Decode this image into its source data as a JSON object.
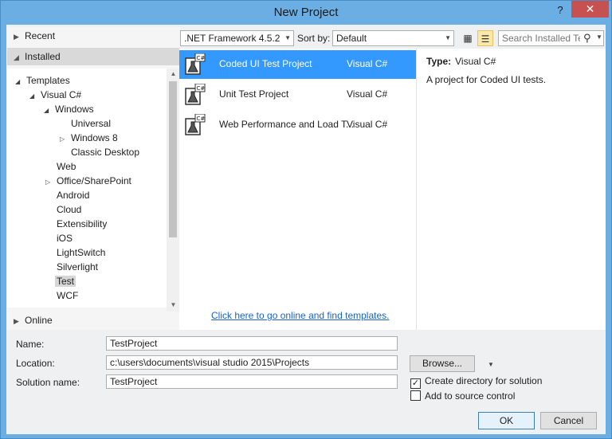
{
  "window": {
    "title": "New Project",
    "help": "?",
    "close": "✕"
  },
  "left": {
    "recent": "Recent",
    "installed": "Installed",
    "online": "Online",
    "tree": [
      {
        "label": "Templates"
      },
      {
        "label": "Visual C#"
      },
      {
        "label": "Windows"
      },
      {
        "label": "Universal"
      },
      {
        "label": "Windows 8"
      },
      {
        "label": "Classic Desktop"
      },
      {
        "label": "Web"
      },
      {
        "label": "Office/SharePoint"
      },
      {
        "label": "Android"
      },
      {
        "label": "Cloud"
      },
      {
        "label": "Extensibility"
      },
      {
        "label": "iOS"
      },
      {
        "label": "LightSwitch"
      },
      {
        "label": "Silverlight"
      },
      {
        "label": "Test"
      },
      {
        "label": "WCF"
      }
    ]
  },
  "toolbar": {
    "framework": ".NET Framework 4.5.2",
    "sort_label": "Sort by:",
    "sort_value": "Default",
    "search_placeholder": "Search Installed Te"
  },
  "templates": [
    {
      "name": "Coded UI Test Project",
      "lang": "Visual C#"
    },
    {
      "name": "Unit Test Project",
      "lang": "Visual C#"
    },
    {
      "name": "Web Performance and Load T...",
      "lang": "Visual C#"
    }
  ],
  "online_link": "Click here to go online and find templates.",
  "description": {
    "type_label": "Type:",
    "type_value": "Visual C#",
    "text": "A project for Coded UI tests."
  },
  "form": {
    "name_label": "Name:",
    "name_value": "TestProject",
    "location_label": "Location:",
    "location_value": "c:\\users\\documents\\visual studio 2015\\Projects",
    "solution_label": "Solution name:",
    "solution_value": "TestProject",
    "browse": "Browse...",
    "create_dir": "Create directory for solution",
    "source_control": "Add to source control",
    "ok": "OK",
    "cancel": "Cancel"
  },
  "colors": {
    "accent": "#3399ff",
    "link": "#1a61c7",
    "close": "#c75050"
  }
}
